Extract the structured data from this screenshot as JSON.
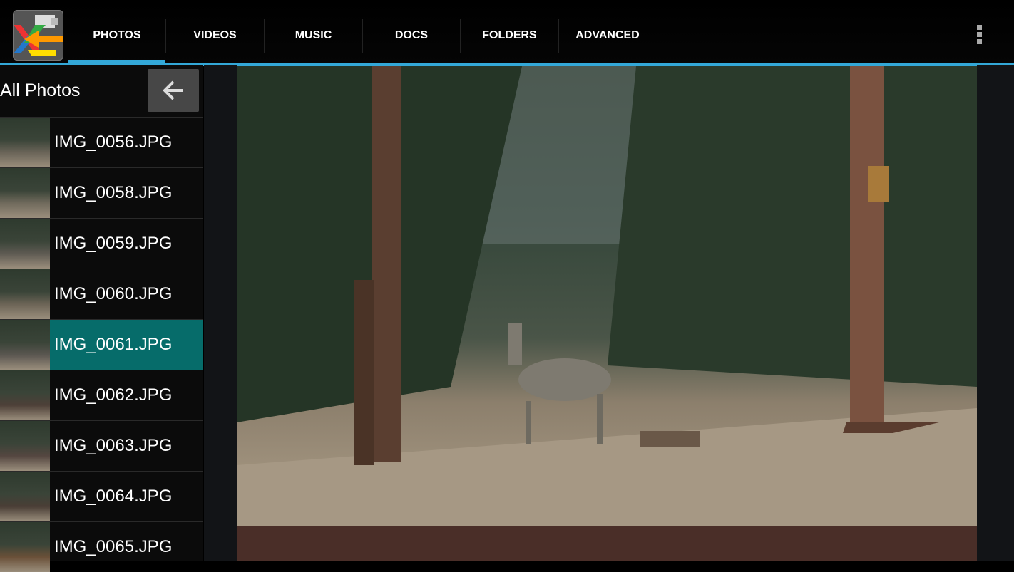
{
  "app": {
    "logo_icon": "usb-transfer-arrows-icon"
  },
  "tabs": [
    {
      "label": "PHOTOS",
      "selected": true
    },
    {
      "label": "VIDEOS"
    },
    {
      "label": "MUSIC"
    },
    {
      "label": "DOCS"
    },
    {
      "label": "FOLDERS"
    },
    {
      "label": "ADVANCED"
    }
  ],
  "accent": "#33a8d8",
  "selected_color": "#066c6a",
  "sidebar": {
    "title": "All Photos",
    "back_icon": "arrow-left-icon",
    "items": [
      {
        "name": "IMG_0056.JPG"
      },
      {
        "name": "IMG_0058.JPG"
      },
      {
        "name": "IMG_0059.JPG"
      },
      {
        "name": "IMG_0060.JPG"
      },
      {
        "name": "IMG_0061.JPG",
        "selected": true
      },
      {
        "name": "IMG_0062.JPG"
      },
      {
        "name": "IMG_0063.JPG"
      },
      {
        "name": "IMG_0064.JPG"
      },
      {
        "name": "IMG_0065.JPG"
      }
    ]
  }
}
